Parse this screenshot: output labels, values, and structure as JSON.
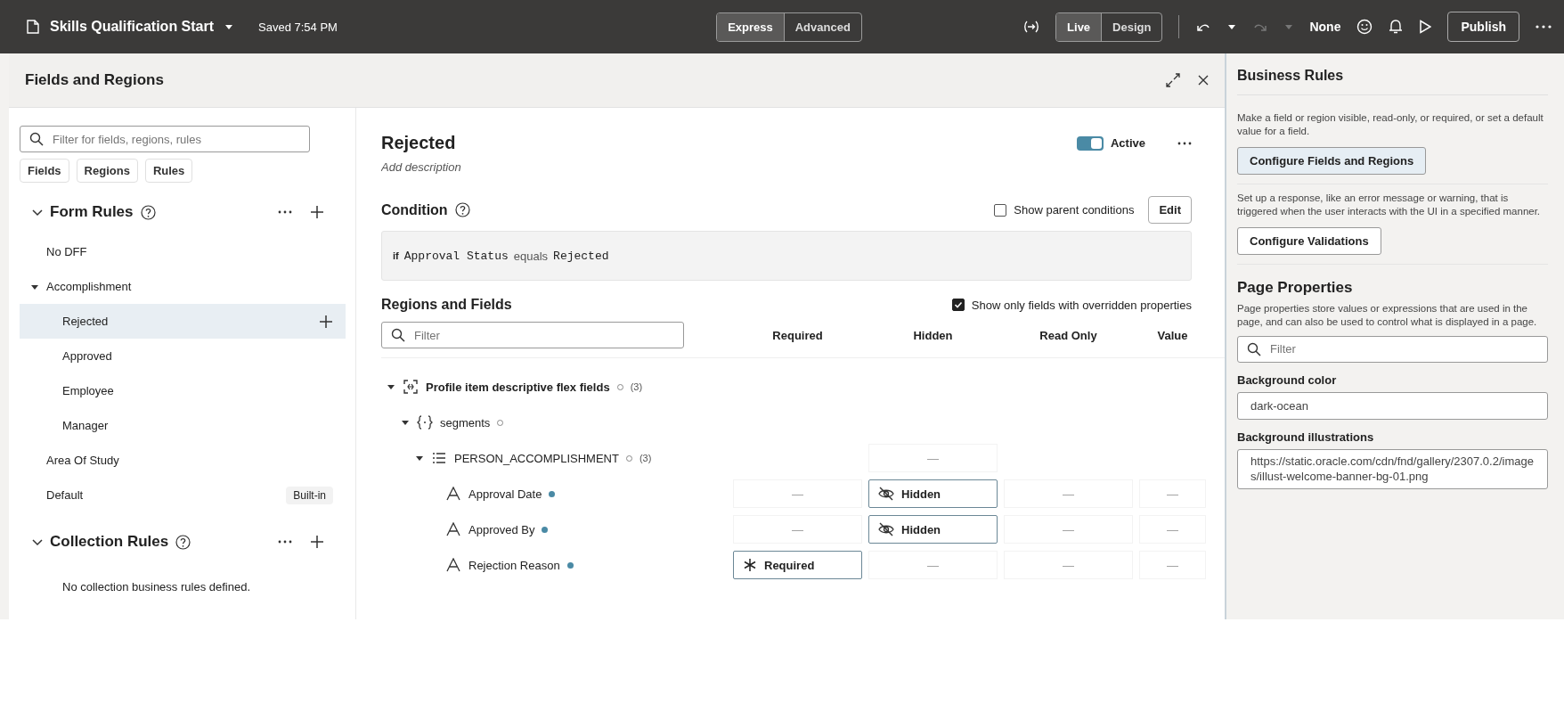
{
  "topbar": {
    "title": "Skills Qualification Start",
    "saved": "Saved 7:54 PM",
    "modes": [
      {
        "label": "Express",
        "selected": true
      },
      {
        "label": "Advanced",
        "selected": false
      }
    ],
    "views": [
      {
        "label": "Live",
        "selected": true
      },
      {
        "label": "Design",
        "selected": false
      }
    ],
    "redo": {
      "disabled": true
    },
    "theme": "None",
    "publish": "Publish"
  },
  "panel": {
    "title": "Fields and Regions"
  },
  "rules_pane": {
    "search_placeholder": "Filter for fields, regions, rules",
    "filters": [
      "Fields",
      "Regions",
      "Rules"
    ],
    "sections": [
      {
        "title": "Form Rules",
        "expanded": true,
        "items": [
          {
            "label": "No DFF",
            "selected": false
          },
          {
            "label": "Accomplishment",
            "selected": false,
            "expanded": true,
            "children": [
              {
                "label": "Rejected",
                "selected": true
              },
              {
                "label": "Approved",
                "selected": false
              },
              {
                "label": "Employee",
                "selected": false
              },
              {
                "label": "Manager",
                "selected": false
              }
            ]
          },
          {
            "label": "Area Of Study",
            "selected": false
          },
          {
            "label": "Default",
            "selected": false,
            "badge": "Built-in"
          }
        ]
      },
      {
        "title": "Collection Rules",
        "expanded": true,
        "empty_text": "No collection business rules defined."
      }
    ]
  },
  "rule": {
    "title": "Rejected",
    "active": {
      "label": "Active",
      "on": true
    },
    "description_placeholder": "Add description",
    "condition": {
      "title": "Condition",
      "show_parent": {
        "label": "Show parent conditions",
        "checked": false
      },
      "edit": "Edit",
      "tokens": [
        {
          "text": "if",
          "kind": "keyword"
        },
        {
          "text": "Approval Status",
          "kind": "field"
        },
        {
          "text": "equals",
          "kind": "operator"
        },
        {
          "text": "Rejected",
          "kind": "value"
        }
      ]
    },
    "fields": {
      "title": "Regions and Fields",
      "show_only": {
        "label": "Show only fields with overridden properties",
        "checked": true
      },
      "filter_placeholder": "Filter",
      "columns": [
        "Required",
        "Hidden",
        "Read Only",
        "Value"
      ],
      "tree": [
        {
          "label": "Profile item descriptive flex fields",
          "kind": "region",
          "overridden": false,
          "count": "(3)",
          "expanded": true,
          "children": [
            {
              "label": "segments",
              "kind": "object",
              "overridden": false,
              "expanded": true,
              "children": [
                {
                  "label": "PERSON_ACCOMPLISHMENT",
                  "kind": "list",
                  "overridden": false,
                  "count": "(3)",
                  "expanded": true,
                  "cells": [
                    {
                      "kind": "blank"
                    },
                    {
                      "kind": "dash",
                      "text": "—"
                    },
                    {
                      "kind": "blank"
                    },
                    {
                      "kind": "blank"
                    }
                  ],
                  "children": [
                    {
                      "label": "Approval Date",
                      "kind": "field",
                      "overridden": true,
                      "cells": [
                        {
                          "kind": "dash",
                          "text": "—"
                        },
                        {
                          "kind": "hidden",
                          "text": "Hidden"
                        },
                        {
                          "kind": "dash",
                          "text": "—"
                        },
                        {
                          "kind": "dash",
                          "text": "—"
                        }
                      ]
                    },
                    {
                      "label": "Approved By",
                      "kind": "field",
                      "overridden": true,
                      "cells": [
                        {
                          "kind": "dash",
                          "text": "—"
                        },
                        {
                          "kind": "hidden",
                          "text": "Hidden"
                        },
                        {
                          "kind": "dash",
                          "text": "—"
                        },
                        {
                          "kind": "dash",
                          "text": "—"
                        }
                      ]
                    },
                    {
                      "label": "Rejection Reason",
                      "kind": "field",
                      "overridden": true,
                      "cells": [
                        {
                          "kind": "required",
                          "text": "Required"
                        },
                        {
                          "kind": "dash",
                          "text": "—"
                        },
                        {
                          "kind": "dash",
                          "text": "—"
                        },
                        {
                          "kind": "dash",
                          "text": "—"
                        }
                      ]
                    }
                  ]
                }
              ]
            }
          ]
        }
      ]
    }
  },
  "business_rules": {
    "title": "Business Rules",
    "actions": [
      {
        "description": "Make a field or region visible, read-only, or required, or set a default value for a field.",
        "button": "Configure Fields and Regions",
        "selected": true
      },
      {
        "description": "Set up a response, like an error message or warning, that is triggered when the user interacts with the UI in a specified manner.",
        "button": "Configure Validations",
        "selected": false
      }
    ]
  },
  "page_properties": {
    "title": "Page Properties",
    "description": "Page properties store values or expressions that are used in the page, and can also be used to control what is displayed in a page.",
    "filter_placeholder": "Filter",
    "properties": [
      {
        "label": "Background color",
        "value": "dark-ocean",
        "kind": "text"
      },
      {
        "label": "Background illustrations",
        "value": "https://static.oracle.com/cdn/fnd/gallery/2307.0.2/images/illust-welcome-banner-bg-01.png",
        "kind": "multiline"
      }
    ]
  }
}
